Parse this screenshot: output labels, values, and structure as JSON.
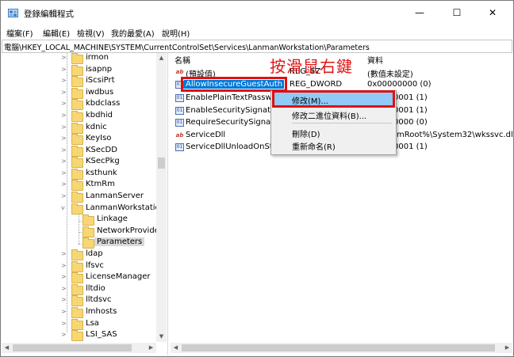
{
  "window": {
    "title": "登錄編輯程式",
    "controls": {
      "minimize": "—",
      "maximize": "☐",
      "close": "✕"
    }
  },
  "menu": [
    "檔案(F)",
    "編輯(E)",
    "檢視(V)",
    "我的最愛(A)",
    "說明(H)"
  ],
  "address": "電腦\\HKEY_LOCAL_MACHINE\\SYSTEM\\CurrentControlSet\\Services\\LanmanWorkstation\\Parameters",
  "tree": {
    "items": [
      {
        "label": "irmon",
        "expandable": true
      },
      {
        "label": "isapnp",
        "expandable": true
      },
      {
        "label": "iScsiPrt",
        "expandable": true
      },
      {
        "label": "iwdbus",
        "expandable": true
      },
      {
        "label": "kbdclass",
        "expandable": true
      },
      {
        "label": "kbdhid",
        "expandable": true
      },
      {
        "label": "kdnic",
        "expandable": true
      },
      {
        "label": "KeyIso",
        "expandable": true
      },
      {
        "label": "KSecDD",
        "expandable": true
      },
      {
        "label": "KSecPkg",
        "expandable": true
      },
      {
        "label": "ksthunk",
        "expandable": true
      },
      {
        "label": "KtmRm",
        "expandable": true
      },
      {
        "label": "LanmanServer",
        "expandable": true
      },
      {
        "label": "LanmanWorkstation",
        "expandable": true,
        "expanded": true
      },
      {
        "label": "Linkage",
        "expandable": false,
        "child": true
      },
      {
        "label": "NetworkProvider",
        "expandable": false,
        "child": true
      },
      {
        "label": "Parameters",
        "expandable": false,
        "child": true,
        "selected": true
      },
      {
        "label": "ldap",
        "expandable": true
      },
      {
        "label": "lfsvc",
        "expandable": true
      },
      {
        "label": "LicenseManager",
        "expandable": true
      },
      {
        "label": "lltdio",
        "expandable": true
      },
      {
        "label": "lltdsvc",
        "expandable": true
      },
      {
        "label": "lmhosts",
        "expandable": true
      },
      {
        "label": "Lsa",
        "expandable": true
      },
      {
        "label": "LSI_SAS",
        "expandable": true
      }
    ]
  },
  "list": {
    "headers": {
      "name": "名稱",
      "data": "資料"
    },
    "rows": [
      {
        "icon": "sz",
        "name": "(預設值)",
        "type": "REG_SZ",
        "data": "(數值未設定)"
      },
      {
        "icon": "dw",
        "name": "AllowInsecureGuestAuth",
        "type": "REG_DWORD",
        "data": "0x00000000 (0)",
        "highlight": true
      },
      {
        "icon": "dw",
        "name": "EnablePlainTextPasswc",
        "type": "",
        "data": "0001 (1)"
      },
      {
        "icon": "dw",
        "name": "EnableSecuritySignatur",
        "type": "",
        "data": "0001 (1)"
      },
      {
        "icon": "dw",
        "name": "RequireSecuritySignatu",
        "type": "",
        "data": "0000 (0)"
      },
      {
        "icon": "sz",
        "name": "ServiceDll",
        "type": "",
        "data": "mRoot%\\System32\\wkssvc.dll"
      },
      {
        "icon": "dw",
        "name": "ServiceDllUnloadOnSto",
        "type": "",
        "data": "0001 (1)"
      }
    ]
  },
  "annotation": "按滑鼠右鍵",
  "context_menu": {
    "items": [
      "修改(M)...",
      "修改二進位資料(B)...",
      "刪除(D)",
      "重新命名(R)"
    ],
    "active_index": 0
  }
}
